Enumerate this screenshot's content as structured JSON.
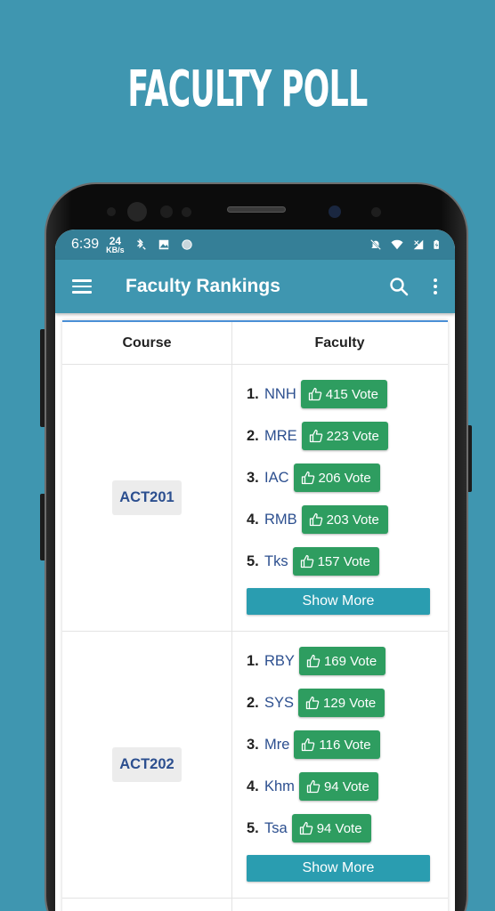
{
  "promo": {
    "title": "FACULTY POLL"
  },
  "status_bar": {
    "time": "6:39",
    "net_speed_value": "24",
    "net_speed_unit": "KB/s",
    "icons_left": [
      "bluetooth-call-icon",
      "image-icon",
      "circle-icon"
    ],
    "icons_right": [
      "notifications-off-icon",
      "wifi-icon",
      "signal-icon",
      "battery-charging-icon"
    ]
  },
  "appbar": {
    "title": "Faculty Rankings",
    "icons": [
      "menu-icon",
      "search-icon",
      "more-vertical-icon"
    ]
  },
  "table": {
    "headers": {
      "course": "Course",
      "faculty": "Faculty"
    },
    "rows": [
      {
        "course": "ACT201",
        "faculty": [
          {
            "rank": "1.",
            "name": "NNH",
            "votes": "415 Vote"
          },
          {
            "rank": "2.",
            "name": "MRE",
            "votes": "223 Vote"
          },
          {
            "rank": "3.",
            "name": "IAC",
            "votes": "206 Vote"
          },
          {
            "rank": "4.",
            "name": "RMB",
            "votes": "203 Vote"
          },
          {
            "rank": "5.",
            "name": "Tks",
            "votes": "157 Vote"
          }
        ],
        "show_more": "Show More"
      },
      {
        "course": "ACT202",
        "faculty": [
          {
            "rank": "1.",
            "name": "RBY",
            "votes": "169 Vote"
          },
          {
            "rank": "2.",
            "name": "SYS",
            "votes": "129 Vote"
          },
          {
            "rank": "3.",
            "name": "Mre",
            "votes": "116 Vote"
          },
          {
            "rank": "4.",
            "name": "Khm",
            "votes": "94 Vote"
          },
          {
            "rank": "5.",
            "name": "Tsa",
            "votes": "94 Vote"
          }
        ],
        "show_more": "Show More"
      }
    ]
  },
  "colors": {
    "background": "#3f96b0",
    "status_bar": "#357f97",
    "vote_button": "#2e9d60",
    "show_more_button": "#2a9db0",
    "link_text": "#2c4f8f"
  }
}
